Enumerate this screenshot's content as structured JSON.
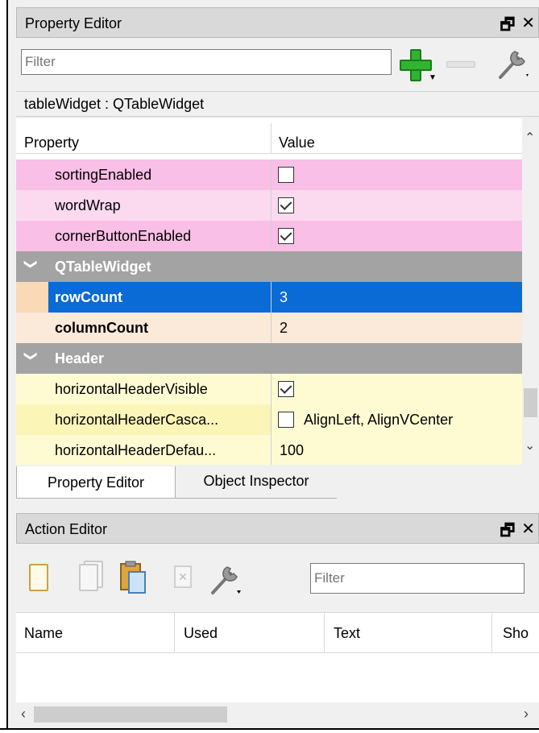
{
  "property_editor": {
    "title": "Property Editor",
    "float_icon": "🗗",
    "close_icon": "✕",
    "filter_placeholder": "Filter",
    "object_label": "tableWidget : QTableWidget",
    "columns": {
      "property": "Property",
      "value": "Value"
    },
    "rows": [
      {
        "name": "sortingEnabled",
        "checked": false
      },
      {
        "name": "wordWrap",
        "checked": true
      },
      {
        "name": "cornerButtonEnabled",
        "checked": true
      }
    ],
    "group_qtablewidget": {
      "label": "QTableWidget",
      "chevron": "❯"
    },
    "row_count": {
      "name": "rowCount",
      "value": "3"
    },
    "column_count": {
      "name": "columnCount",
      "value": "2"
    },
    "group_header": {
      "label": "Header",
      "chevron": "❯"
    },
    "header_rows": [
      {
        "name": "horizontalHeaderVisible",
        "checked": true,
        "value": ""
      },
      {
        "name": "horizontalHeaderCasca...",
        "checked": false,
        "value": "AlignLeft, AlignVCenter"
      },
      {
        "name": "horizontalHeaderDefau...",
        "value": "100"
      }
    ],
    "scroll_up": "⌃",
    "scroll_down": "⌄"
  },
  "tabs": {
    "property_editor": "Property Editor",
    "object_inspector": "Object Inspector"
  },
  "action_editor": {
    "title": "Action Editor",
    "float_icon": "🗗",
    "close_icon": "✕",
    "filter_placeholder": "Filter",
    "columns": {
      "name": "Name",
      "used": "Used",
      "text": "Text",
      "shortcut": "Sho"
    },
    "scroll_left": "‹",
    "scroll_right": "›"
  },
  "colors": {
    "pink_dark": "#f9bfe6",
    "pink_light": "#fbd9ef",
    "peach": "#fbe9d9",
    "peach_dark": "#f9d9b6",
    "yellow": "#fefbd3",
    "yellow_dark": "#fbf5b8",
    "selection": "#0a6ad6",
    "group": "#a3a3a3"
  }
}
